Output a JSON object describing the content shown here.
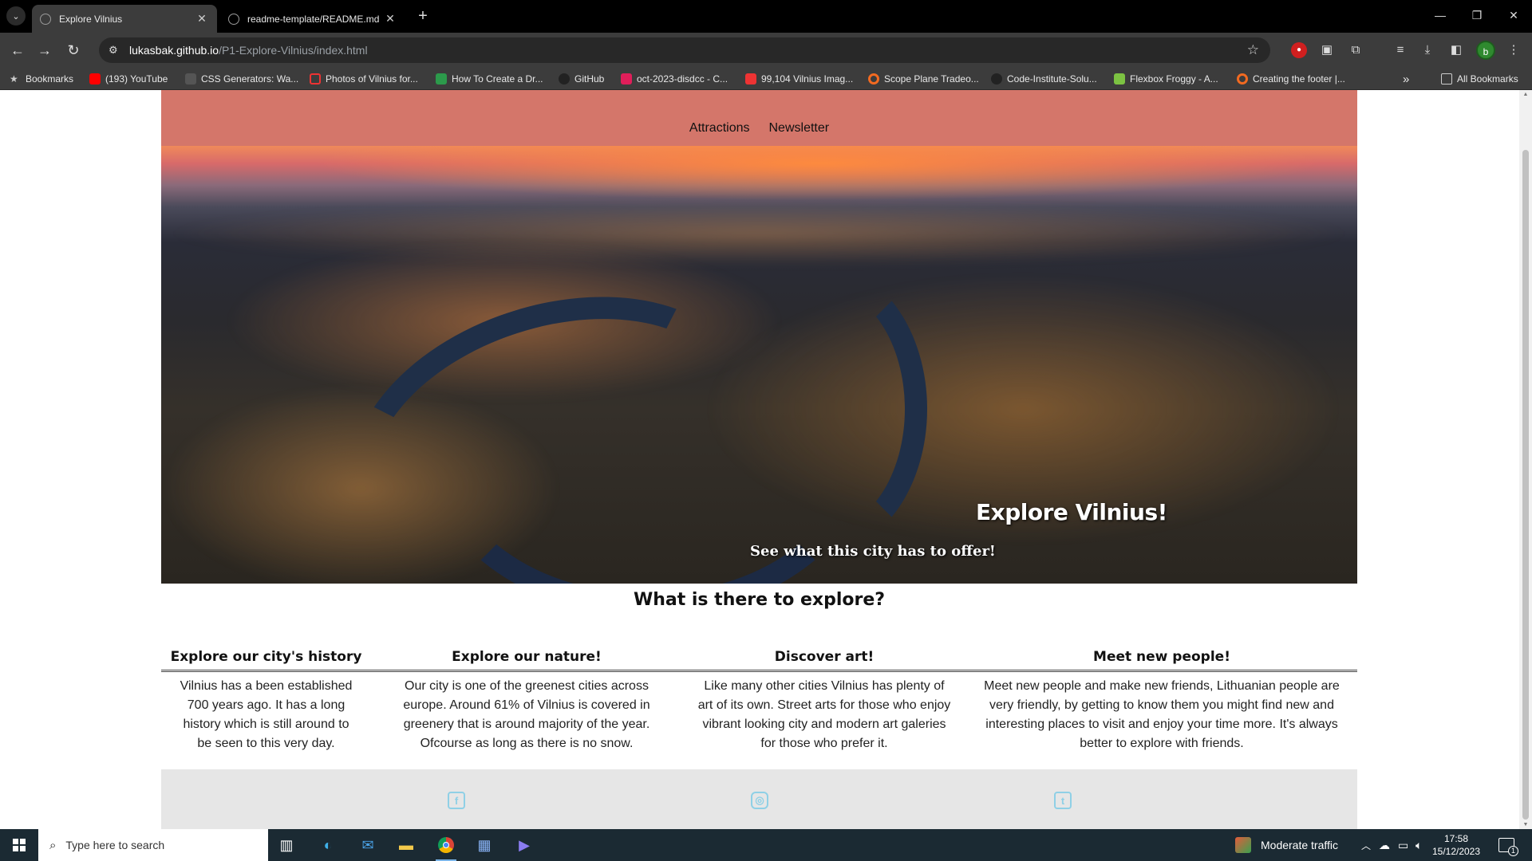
{
  "browser": {
    "tabs": [
      {
        "title": "Explore Vilnius",
        "active": true
      },
      {
        "title": "readme-template/README.md",
        "active": false
      }
    ],
    "url_host": "lukasbak.github.io",
    "url_path": "/P1-Explore-Vilnius/index.html",
    "profile_initial": "b",
    "bookmarks": [
      "Bookmarks",
      "(193) YouTube",
      "CSS Generators: Wa...",
      "Photos of Vilnius for...",
      "How To Create a Dr...",
      "GitHub",
      "oct-2023-disdcc - C...",
      "99,104 Vilnius Imag...",
      "Scope Plane Tradeo...",
      "Code-Institute-Solu...",
      "Flexbox Froggy - A...",
      "Creating the footer |..."
    ],
    "all_bookmarks": "All Bookmarks",
    "more_bookmarks": "»"
  },
  "site": {
    "nav": [
      "Attractions",
      "Newsletter"
    ],
    "hero_title": "Explore Vilnius!",
    "hero_subtitle": "See what this city has to offer!",
    "section_title": "What is there to explore?",
    "cards": [
      {
        "title": "Explore our city's history",
        "text": "Vilnius has a been established 700 years ago. It has a long history which is still around to be seen to this very day."
      },
      {
        "title": "Explore our nature!",
        "text": "Our city is one of the greenest cities across europe. Around 61% of Vilnius is covered in greenery that is around majority of the year. Ofcourse as long as there is no snow."
      },
      {
        "title": "Discover art!",
        "text": "Like many other cities Vilnius has plenty of art of its own. Street arts for those who enjoy vibrant looking city and modern art galeries for those who prefer it."
      },
      {
        "title": "Meet new people!",
        "text": "Meet new people and make new friends, Lithuanian people are very friendly, by getting to know them you might find new and interesting places to visit and enjoy your time more. It's always better to explore with friends."
      }
    ],
    "footer_icons": [
      "facebook-icon",
      "instagram-icon",
      "twitter-icon"
    ]
  },
  "taskbar": {
    "search_placeholder": "Type here to search",
    "weather": "Moderate traffic",
    "time": "17:58",
    "date": "15/12/2023",
    "notification_count": "1"
  }
}
